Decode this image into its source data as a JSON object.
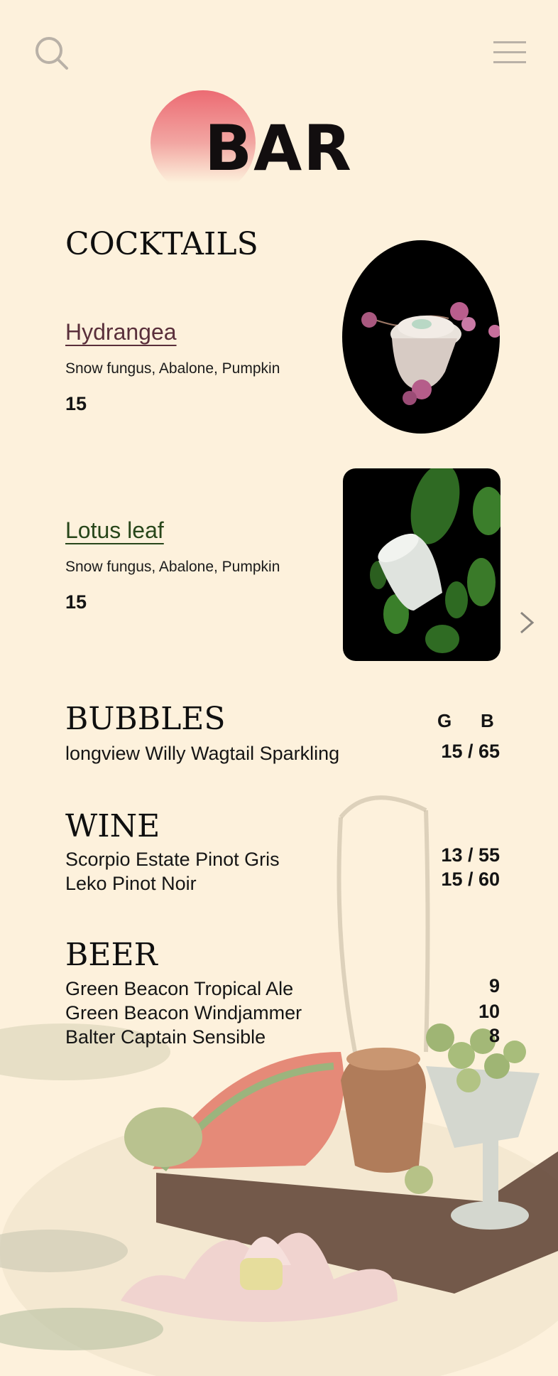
{
  "header": {
    "title": "BAR",
    "search_icon": "search-icon",
    "menu_icon": "hamburger-menu-icon"
  },
  "colors": {
    "background": "#fdf1dc",
    "sun_top": "#ec6b73",
    "hydrangea": "#5a2f3b",
    "lotus": "#28461a",
    "text": "#141414"
  },
  "cocktails": {
    "title": "COCKTAILS",
    "items": [
      {
        "name": "Hydrangea",
        "ingredients": "Snow fungus, Abalone, Pumpkin",
        "price": "15"
      },
      {
        "name": "Lotus leaf",
        "ingredients": "Snow fungus, Abalone, Pumpkin",
        "price": "15"
      }
    ],
    "next_icon": "chevron-right-icon"
  },
  "bubbles": {
    "title": "BUBBLES",
    "col_glass": "G",
    "col_bottle": "B",
    "items": [
      {
        "name": "longview Willy Wagtail Sparkling",
        "price": "15 / 65"
      }
    ]
  },
  "wine": {
    "title": "WINE",
    "items": [
      {
        "name": "Scorpio Estate Pinot Gris",
        "price": "13 / 55"
      },
      {
        "name": "Leko Pinot Noir",
        "price": "15 / 60"
      }
    ]
  },
  "beer": {
    "title": "BEER",
    "items": [
      {
        "name": "Green Beacon Tropical Ale",
        "price": "9"
      },
      {
        "name": "Green Beacon Windjammer",
        "price": "10"
      },
      {
        "name": "Balter Captain Sensible",
        "price": "8"
      }
    ]
  }
}
